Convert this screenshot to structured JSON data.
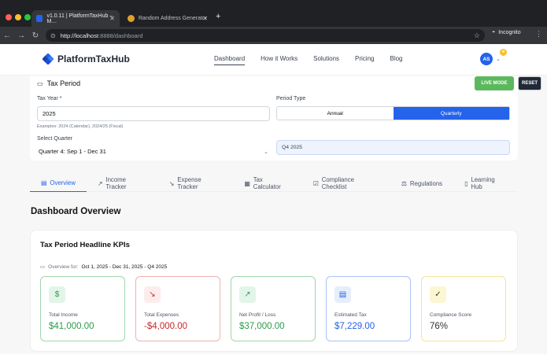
{
  "browser": {
    "tabs": [
      {
        "title": "v1.0.11 | PlatformTaxHub – M…",
        "active": true
      },
      {
        "title": "Random Address Generator",
        "active": false
      }
    ],
    "url_host": "http://localhost",
    "url_rest": ":8888/dashboard",
    "incognito_label": "Incognito"
  },
  "header": {
    "brand": "PlatformTaxHub",
    "nav": [
      "Dashboard",
      "How it Works",
      "Solutions",
      "Pricing",
      "Blog"
    ],
    "avatar_initials": "AS"
  },
  "tax_period": {
    "title": "Tax Period",
    "live_mode_label": "LIVE MODE",
    "reset_label": "RESET",
    "tax_year_label": "Tax Year *",
    "tax_year_value": "2025",
    "tax_year_hint": "Examples: 2024 (Calendar), 2024/25 (Fiscal)",
    "period_type_label": "Period Type",
    "period_options": [
      "Annual",
      "Quarterly"
    ],
    "period_selected": "Quarterly",
    "select_quarter_label": "Select Quarter",
    "select_quarter_value": "Quarter 4: Sep 1 - Dec 31",
    "quarter_display": "Q4 2025"
  },
  "tabs": [
    {
      "label": "Overview",
      "icon": "chart-icon",
      "active": true
    },
    {
      "label": "Income Tracker",
      "icon": "trend-up-icon",
      "active": false
    },
    {
      "label": "Expense Tracker",
      "icon": "trend-down-icon",
      "active": false
    },
    {
      "label": "Tax Calculator",
      "icon": "calculator-icon",
      "active": false
    },
    {
      "label": "Compliance Checklist",
      "icon": "checkbox-icon",
      "active": false
    },
    {
      "label": "Regulations",
      "icon": "scale-icon",
      "active": false
    },
    {
      "label": "Learning Hub",
      "icon": "book-icon",
      "active": false
    }
  ],
  "dashboard": {
    "title": "Dashboard Overview",
    "kpi_title": "Tax Period Headline KPIs",
    "overview_prefix": "Overview for:",
    "overview_range": "Oct 1, 2025 - Dec 31, 2025 - Q4 2025",
    "kpis": [
      {
        "label": "Total Income",
        "value": "$41,000.00",
        "icon": "dollar-icon",
        "color": "#2e9a4b"
      },
      {
        "label": "Total Expenses",
        "value": "-$4,000.00",
        "icon": "trend-down-icon",
        "color": "#c62828"
      },
      {
        "label": "Net Profit / Loss",
        "value": "$37,000.00",
        "icon": "trend-up-icon",
        "color": "#2e9a4b"
      },
      {
        "label": "Estimated Tax",
        "value": "$7,229.00",
        "icon": "receipt-icon",
        "color": "#2563eb"
      },
      {
        "label": "Compliance Score",
        "value": "76%",
        "icon": "check-circle-icon",
        "color": "#333333"
      }
    ]
  }
}
